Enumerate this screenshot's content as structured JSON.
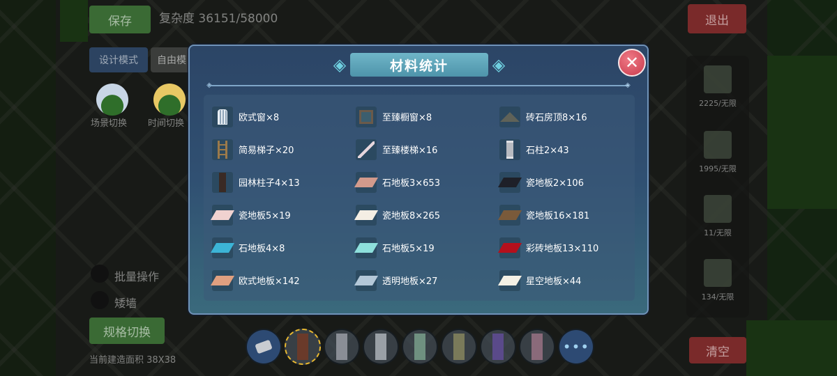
{
  "hud": {
    "save_label": "保存",
    "complexity_text": "复杂度 36151/58000",
    "design_mode_label": "设计模式",
    "free_mode_label": "自由模",
    "exit_label": "退出",
    "clear_label": "清空",
    "spec_switch_label": "规格切换",
    "build_area_text": "当前建造面积 38X38",
    "scene_switch_label": "场景切换",
    "time_switch_label": "时间切换",
    "batch_label": "批量操作",
    "short_wall_label": "矮墙"
  },
  "right_panel": {
    "items": [
      {
        "icon": "floor-block-icon",
        "count": "2225/无限"
      },
      {
        "icon": "wall-block-icon",
        "count": "1995/无限"
      },
      {
        "icon": "window-block-icon",
        "count": "11/无限"
      },
      {
        "icon": "stairs-block-icon",
        "count": "134/无限"
      }
    ]
  },
  "bottom_bar": {
    "more_label": "•••"
  },
  "modal": {
    "title": "材料统计",
    "close_symbol": "✕",
    "ornament": "◈",
    "items": [
      {
        "label": "欧式窗×8",
        "icon": "european-window-icon"
      },
      {
        "label": "至臻橱窗×8",
        "icon": "showcase-window-icon"
      },
      {
        "label": "砖石房顶8×16",
        "icon": "stone-roof-icon"
      },
      {
        "label": "简易梯子×20",
        "icon": "simple-ladder-icon"
      },
      {
        "label": "至臻楼梯×16",
        "icon": "deluxe-stairs-icon"
      },
      {
        "label": "石柱2×43",
        "icon": "stone-column-icon"
      },
      {
        "label": "园林柱子4×13",
        "icon": "garden-pillar-icon"
      },
      {
        "label": "石地板3×653",
        "icon": "stone-floor-icon",
        "color": "#d29a8c"
      },
      {
        "label": "瓷地板2×106",
        "icon": "tile-floor-icon",
        "color": "#1e2028"
      },
      {
        "label": "瓷地板5×19",
        "icon": "tile-floor-icon",
        "color": "#f0d2d0"
      },
      {
        "label": "瓷地板8×265",
        "icon": "tile-floor-icon",
        "color": "#f4eee4"
      },
      {
        "label": "瓷地板16×181",
        "icon": "tile-floor-icon",
        "color": "#7a5a3a"
      },
      {
        "label": "石地板4×8",
        "icon": "stone-floor-icon",
        "color": "#3cb4d6"
      },
      {
        "label": "石地板5×19",
        "icon": "stone-floor-icon",
        "color": "#8ee0dc"
      },
      {
        "label": "彩砖地板13×110",
        "icon": "color-brick-floor-icon",
        "color": "#b4101c"
      },
      {
        "label": "欧式地板×142",
        "icon": "european-floor-icon",
        "color": "#e0a080"
      },
      {
        "label": "透明地板×27",
        "icon": "transparent-floor-icon",
        "color": "#b4c8d8"
      },
      {
        "label": "星空地板×44",
        "icon": "starry-floor-icon",
        "color": "#f4f0e4"
      }
    ]
  }
}
